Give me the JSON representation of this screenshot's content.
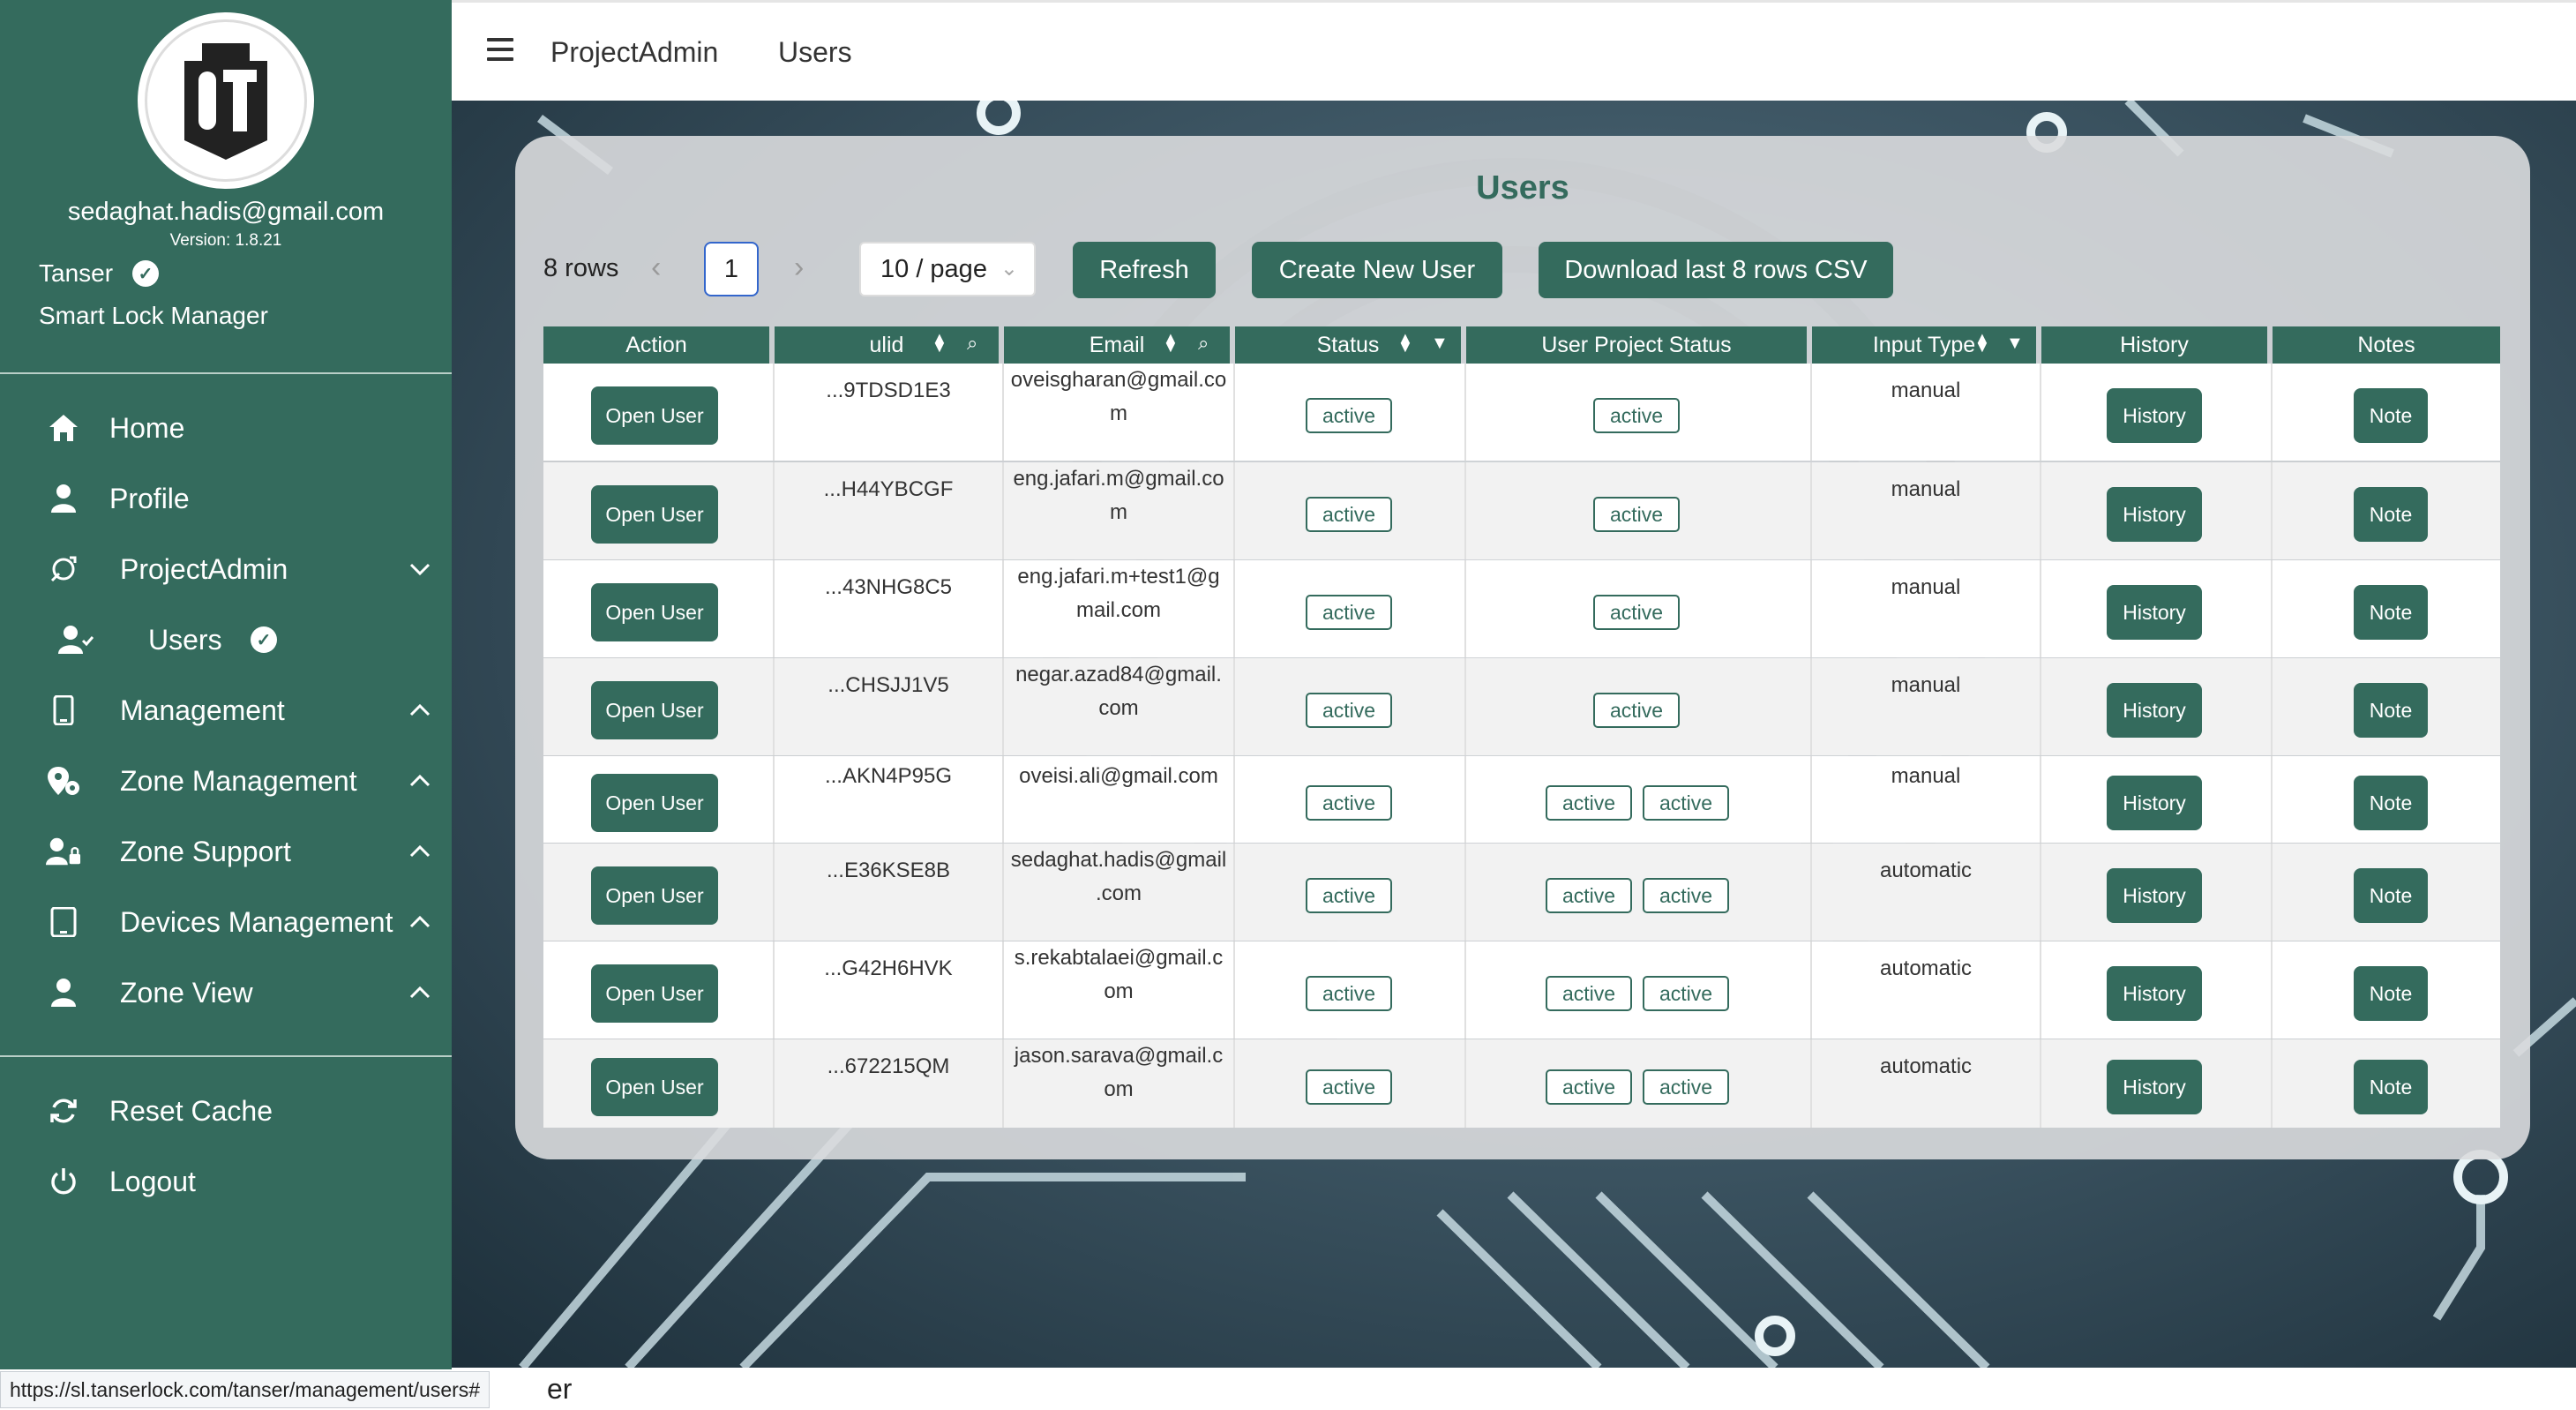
{
  "sidebar": {
    "email": "sedaghat.hadis@gmail.com",
    "version": "Version: 1.8.21",
    "org_name": "Tanser",
    "org_subtitle": "Smart Lock Manager",
    "items": [
      {
        "label": "Home",
        "icon": "home-icon"
      },
      {
        "label": "Profile",
        "icon": "user-icon"
      },
      {
        "label": "ProjectAdmin",
        "icon": "refresh-ring-icon",
        "chevron": "down"
      },
      {
        "label": "Users",
        "icon": "user-check-icon"
      },
      {
        "label": "Management",
        "icon": "phone-icon",
        "chevron": "up"
      },
      {
        "label": "Zone Management",
        "icon": "location-gear-icon",
        "chevron": "up"
      },
      {
        "label": "Zone Support",
        "icon": "user-lock-icon",
        "chevron": "up"
      },
      {
        "label": "Devices Management",
        "icon": "tablet-icon",
        "chevron": "up"
      },
      {
        "label": "Zone View",
        "icon": "user-icon",
        "chevron": "up"
      }
    ],
    "bottom_items": [
      {
        "label": "Reset Cache",
        "icon": "sync-icon"
      },
      {
        "label": "Logout",
        "icon": "power-icon"
      }
    ]
  },
  "topbar": {
    "breadcrumb": [
      "ProjectAdmin",
      "Users"
    ]
  },
  "card": {
    "title": "Users",
    "rows_count": "8 rows",
    "current_page": "1",
    "page_size": "10 / page",
    "refresh_label": "Refresh",
    "create_label": "Create New User",
    "download_label": "Download last 8 rows CSV"
  },
  "table": {
    "columns": [
      "Action",
      "ulid",
      "Email",
      "Status",
      "User Project Status",
      "Input Type",
      "History",
      "Notes"
    ],
    "action_label": "Open User",
    "history_label": "History",
    "note_label": "Note",
    "rows": [
      {
        "ulid": "...9TDSD1E3",
        "email": [
          "oveisgharan@gmail.co",
          "m"
        ],
        "status": "active",
        "project_status": [
          "active"
        ],
        "input_type": "manual"
      },
      {
        "ulid": "...H44YBCGF",
        "email": [
          "eng.jafari.m@gmail.co",
          "m"
        ],
        "status": "active",
        "project_status": [
          "active"
        ],
        "input_type": "manual"
      },
      {
        "ulid": "...43NHG8C5",
        "email": [
          "eng.jafari.m+test1@g",
          "mail.com"
        ],
        "status": "active",
        "project_status": [
          "active"
        ],
        "input_type": "manual"
      },
      {
        "ulid": "...CHSJJ1V5",
        "email": [
          "negar.azad84@gmail.",
          "com"
        ],
        "status": "active",
        "project_status": [
          "active"
        ],
        "input_type": "manual"
      },
      {
        "ulid": "...AKN4P95G",
        "email": [
          "oveisi.ali@gmail.com"
        ],
        "status": "active",
        "project_status": [
          "active",
          "active"
        ],
        "input_type": "manual"
      },
      {
        "ulid": "...E36KSE8B",
        "email": [
          "sedaghat.hadis@gmail",
          ".com"
        ],
        "status": "active",
        "project_status": [
          "active",
          "active"
        ],
        "input_type": "automatic"
      },
      {
        "ulid": "...G42H6HVK",
        "email": [
          "s.rekabtalaei@gmail.c",
          "om"
        ],
        "status": "active",
        "project_status": [
          "active",
          "active"
        ],
        "input_type": "automatic"
      },
      {
        "ulid": "...672215QM",
        "email": [
          "jason.sarava@gmail.c",
          "om"
        ],
        "status": "active",
        "project_status": [
          "active",
          "active"
        ],
        "input_type": "automatic"
      }
    ]
  },
  "statusbar": {
    "url": "https://sl.tanserlock.com/tanser/management/users#",
    "tail": "er"
  },
  "colors": {
    "brand": "#346b5d",
    "pager_active": "#3366cc"
  }
}
